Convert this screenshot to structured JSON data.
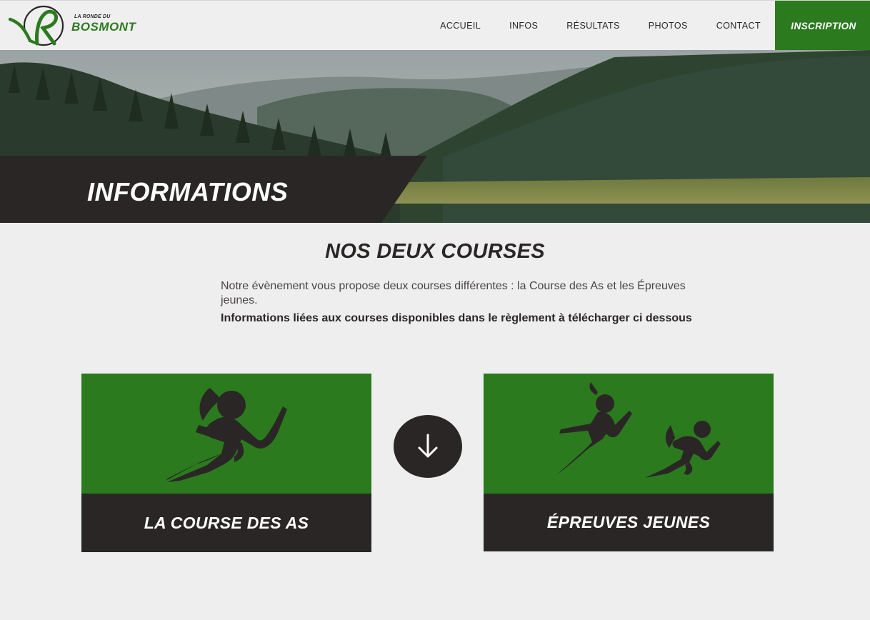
{
  "header": {
    "logo_small": "LA RONDE DU",
    "logo_big": "BOSMONT",
    "nav": [
      {
        "label": "ACCUEIL"
      },
      {
        "label": "INFOS"
      },
      {
        "label": "RÉSULTATS"
      },
      {
        "label": "PHOTOS"
      },
      {
        "label": "CONTACT"
      }
    ],
    "cta_label": "INSCRIPTION"
  },
  "hero": {
    "title": "INFORMATIONS"
  },
  "main": {
    "title": "NOS DEUX COURSES",
    "intro_text": "Notre évènement vous propose deux courses différentes : la Course des As et les Épreuves jeunes.",
    "intro_bold": "Informations liées aux courses disponibles dans le règlement à télécharger ci dessous"
  },
  "cards": [
    {
      "label": "LA COURSE DES AS",
      "icon": "runner-icon"
    },
    {
      "label": "ÉPREUVES JEUNES",
      "icon": "runners-icon"
    }
  ],
  "download": {
    "icon": "arrow-down-icon"
  },
  "colors": {
    "green": "#2b7a1e",
    "dark": "#2b2626",
    "background": "#eeeeee"
  }
}
